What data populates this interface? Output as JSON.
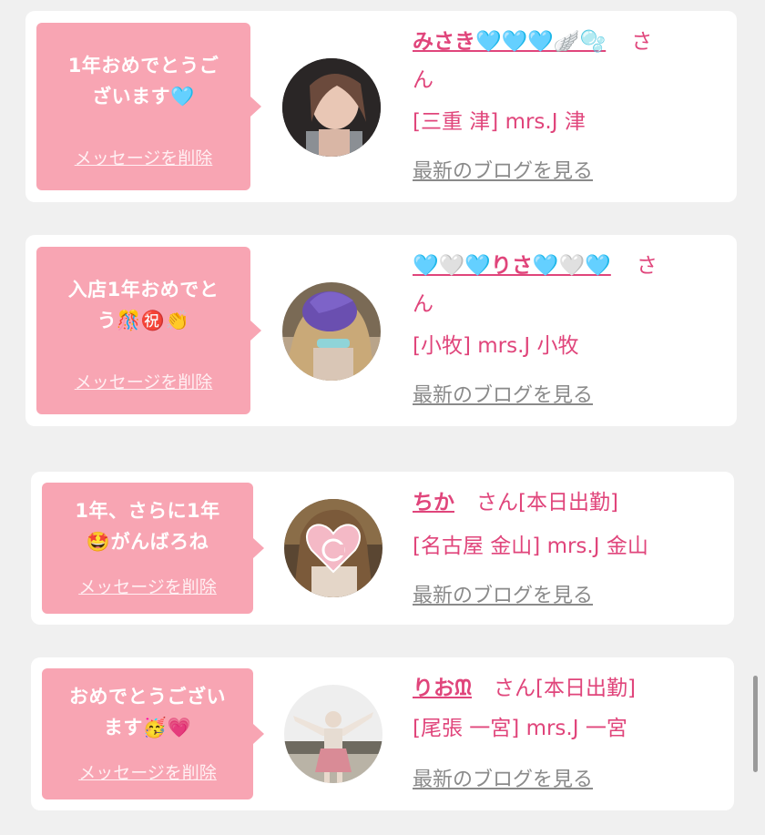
{
  "messages": [
    {
      "message_lines": [
        "1年おめでとうご",
        "ざいます🩵"
      ],
      "delete_label": "メッセージを削除",
      "name": "みさき🩵🩵🩵🪽🫧",
      "honorific": "さ",
      "honorific_wrap": "ん",
      "shop": "[三重 津] mrs.J 津",
      "blog_link": "最新のブログを見る"
    },
    {
      "message_lines": [
        "入店1年おめでと",
        "う🎊㊗️👏"
      ],
      "delete_label": "メッセージを削除",
      "name": "🩵🤍🩵りさ🩵🤍🩵",
      "honorific": "さ",
      "honorific_wrap": "ん",
      "shop": "[小牧] mrs.J 小牧",
      "blog_link": "最新のブログを見る"
    },
    {
      "message_lines": [
        "1年、さらに1年",
        "🤩がんばろね"
      ],
      "delete_label": "メッセージを削除",
      "name": "ちか",
      "honorific": "さん[本日出勤]",
      "shop": "[名古屋 金山] mrs.J 金山",
      "blog_link": "最新のブログを見る"
    },
    {
      "message_lines": [
        "おめでとうござい",
        "ます🥳💗"
      ],
      "delete_label": "メッセージを削除",
      "name": "りおᙢ",
      "honorific": "さん[本日出勤]",
      "shop": "[尾張 一宮] mrs.J 一宮",
      "blog_link": "最新のブログを見る"
    }
  ],
  "colors": {
    "bubble": "#f8a5b3",
    "name": "#e0457b",
    "link": "#8a8a8a",
    "background": "#f0f0f0"
  }
}
